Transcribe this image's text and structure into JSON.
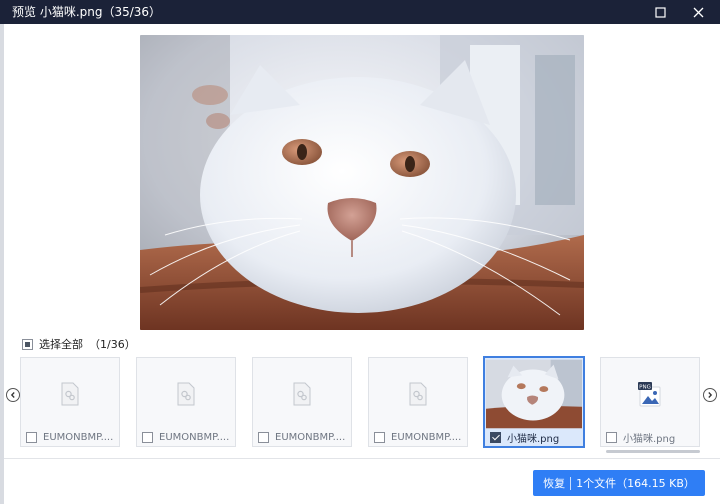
{
  "window": {
    "title": "预览 小猫咪.png（35/36）",
    "maximize_icon": "maximize-icon",
    "close_icon": "close-icon"
  },
  "preview": {
    "image": "white-cat-closeup",
    "colors": {
      "fur": "#eef1f6",
      "nose": "#b98477",
      "eyes": "#b87b5f",
      "floor": "#8a4a30"
    }
  },
  "selection": {
    "select_all_label": "选择全部",
    "count": "（1/36）"
  },
  "thumbnails": [
    {
      "name": "EUMONBMP....",
      "icon": "file-placeholder-icon",
      "checked": false,
      "selected": false
    },
    {
      "name": "EUMONBMP....",
      "icon": "file-placeholder-icon",
      "checked": false,
      "selected": false
    },
    {
      "name": "EUMONBMP....",
      "icon": "file-placeholder-icon",
      "checked": false,
      "selected": false
    },
    {
      "name": "EUMONBMP....",
      "icon": "file-placeholder-icon",
      "checked": false,
      "selected": false
    },
    {
      "name": "小猫咪.png",
      "icon": "cat-thumbnail",
      "checked": true,
      "selected": true
    },
    {
      "name": "小猫咪.png",
      "icon": "png-file-icon",
      "checked": false,
      "selected": false,
      "badge": "PNG"
    }
  ],
  "nav": {
    "prev_icon": "chevron-left-icon",
    "next_icon": "chevron-right-icon"
  },
  "footer": {
    "recover_label": "恢复",
    "file_summary": "1个文件（164.15 KB）",
    "accent": "#2f7ef5"
  }
}
